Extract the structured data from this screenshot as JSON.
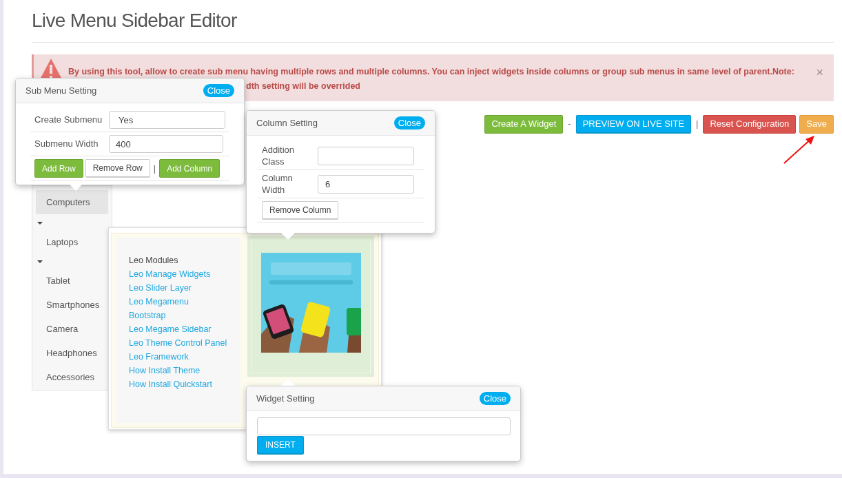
{
  "page": {
    "title": "Live Menu Sidebar Editor"
  },
  "alert": {
    "lines": [
      "By using this tool, allow to create sub menu having multiple rows and multiple columns. You can inject widgets inside columns or group sub menus in same level of parent.Note:",
      "dth setting will be overrided"
    ],
    "close": "×"
  },
  "toolbar": [
    {
      "kind": "success",
      "label": "Create A Widget"
    },
    {
      "kind": "separator",
      "label": "-"
    },
    {
      "kind": "info",
      "label": "PREVIEW ON LIVE SITE"
    },
    {
      "kind": "separator",
      "label": "|"
    },
    {
      "kind": "danger",
      "label": "Reset Configuration"
    },
    {
      "kind": "warning",
      "label": "Save"
    }
  ],
  "menu": {
    "items": [
      {
        "label": "Computers",
        "selected": true,
        "caret": true
      },
      {
        "label": "Laptops",
        "selected": false,
        "caret": true
      },
      {
        "label": "Tablet",
        "selected": false,
        "caret": false
      },
      {
        "label": "Smartphones",
        "selected": false,
        "caret": false
      },
      {
        "label": "Camera",
        "selected": false,
        "caret": false
      },
      {
        "label": "Headphones",
        "selected": false,
        "caret": false
      },
      {
        "label": "Accessories",
        "selected": false,
        "caret": false
      }
    ]
  },
  "submenu": {
    "heading": "Leo Modules",
    "links": [
      "Leo Manage Widgets",
      "Leo Slider Layer",
      "Leo Megamenu",
      "Bootstrap",
      "Leo Megame Sidebar",
      "Leo Theme Control Panel",
      "Leo Framework",
      "How Install Theme",
      "How Install Quickstart"
    ]
  },
  "sub_menu_setting": {
    "title": "Sub Menu Setting",
    "close": "Close",
    "fields": [
      {
        "label": "Create Submenu",
        "value": "Yes"
      },
      {
        "label": "Submenu Width",
        "value": "400"
      }
    ],
    "buttons": [
      {
        "kind": "success",
        "label": "Add Row"
      },
      {
        "kind": "default",
        "label": "Remove Row"
      },
      {
        "kind": "separator",
        "label": "|"
      },
      {
        "kind": "success",
        "label": "Add Column"
      }
    ]
  },
  "column_setting": {
    "title": "Column Setting",
    "close": "Close",
    "fields": [
      {
        "label": "Addition Class"
      },
      {
        "label": "Column Width",
        "value": "6"
      }
    ],
    "buttons": [
      {
        "kind": "default",
        "label": "Remove Column"
      }
    ]
  },
  "widget_setting": {
    "title": "Widget Setting",
    "close": "Close",
    "button": "INSERT"
  }
}
